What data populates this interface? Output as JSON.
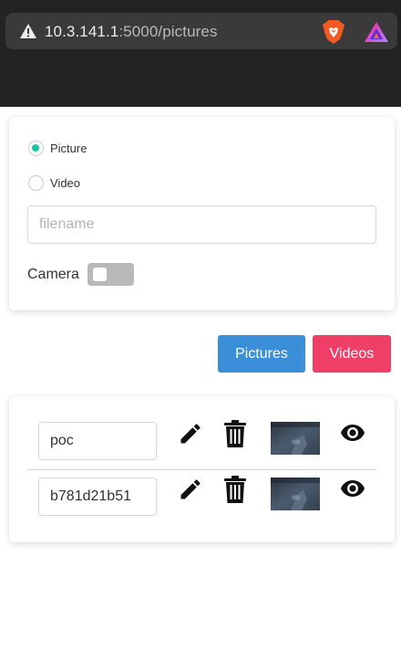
{
  "browser": {
    "url_host": "10.3.141.1",
    "url_path": ":5000/pictures",
    "icons": {
      "warning": "warning-triangle-icon",
      "brave": "brave-lion-icon",
      "rewards": "brave-rewards-icon"
    }
  },
  "form": {
    "media_types": [
      {
        "label": "Picture",
        "checked": true
      },
      {
        "label": "Video",
        "checked": false
      }
    ],
    "filename_placeholder": "filename",
    "camera_label": "Camera",
    "camera_enabled": false
  },
  "buttons": {
    "pictures_label": "Pictures",
    "videos_label": "Videos"
  },
  "files": [
    {
      "name": "poc"
    },
    {
      "name": "b781d21b51"
    }
  ],
  "colors": {
    "radio_accent": "#16c4a8",
    "pictures_button": "#3b8fd8",
    "videos_button": "#ef3f66",
    "toggle_off": "#b9b9b9"
  }
}
